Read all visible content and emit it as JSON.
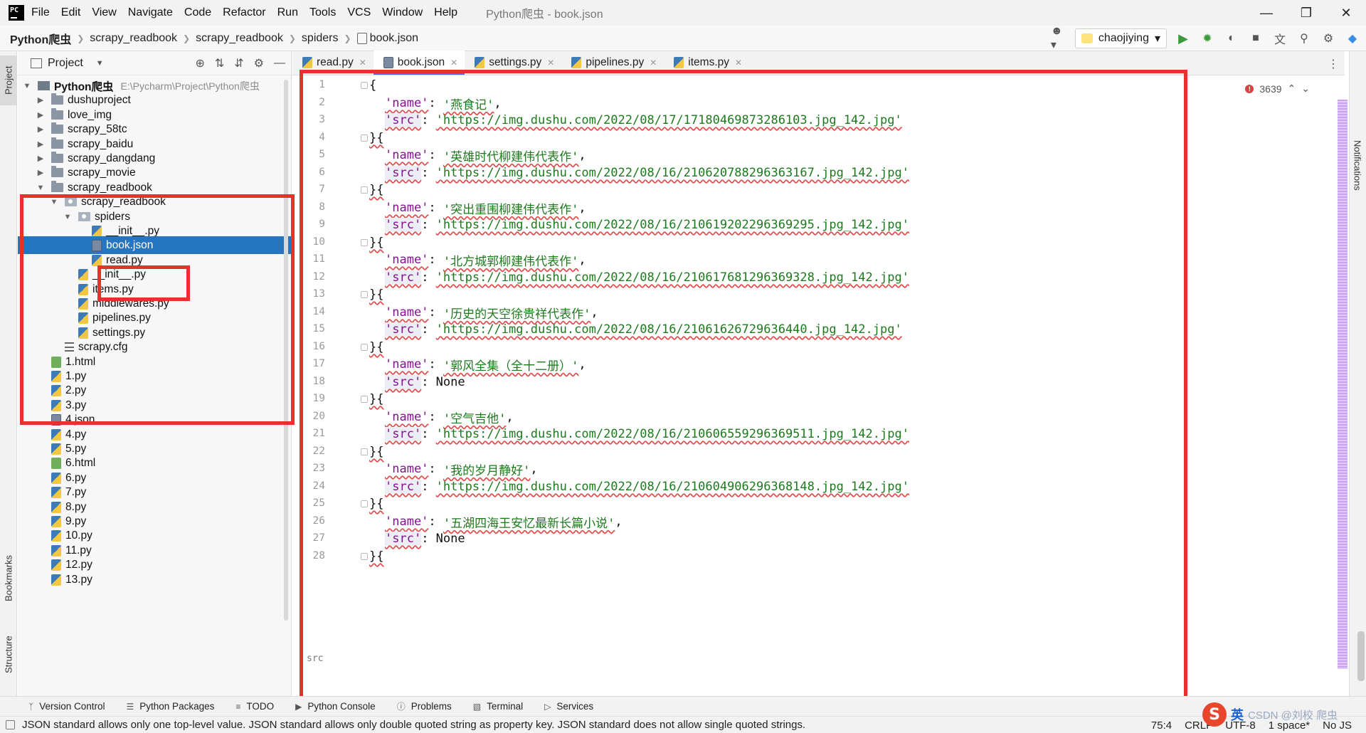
{
  "menubar": {
    "items": [
      "File",
      "Edit",
      "View",
      "Navigate",
      "Code",
      "Refactor",
      "Run",
      "Tools",
      "VCS",
      "Window",
      "Help"
    ],
    "window_title": "Python爬虫 - book.json"
  },
  "breadcrumb": [
    "Python爬虫",
    "scrapy_readbook",
    "scrapy_readbook",
    "spiders",
    "book.json"
  ],
  "toolbar": {
    "run_config": "chaojiying"
  },
  "project_panel": {
    "title": "Project",
    "root_name": "Python爬虫",
    "root_path": "E:\\Pycharm\\Project\\Python爬虫",
    "rows": [
      {
        "label": "dushuproject",
        "level": 1,
        "kind": "folder",
        "toggle": "collapsed"
      },
      {
        "label": "love_img",
        "level": 1,
        "kind": "folder",
        "toggle": "collapsed"
      },
      {
        "label": "scrapy_58tc",
        "level": 1,
        "kind": "folder",
        "toggle": "collapsed"
      },
      {
        "label": "scrapy_baidu",
        "level": 1,
        "kind": "folder",
        "toggle": "collapsed"
      },
      {
        "label": "scrapy_dangdang",
        "level": 1,
        "kind": "folder",
        "toggle": "collapsed"
      },
      {
        "label": "scrapy_movie",
        "level": 1,
        "kind": "folder",
        "toggle": "collapsed"
      },
      {
        "label": "scrapy_readbook",
        "level": 1,
        "kind": "folder",
        "toggle": "expanded"
      },
      {
        "label": "scrapy_readbook",
        "level": 2,
        "kind": "package",
        "toggle": "expanded"
      },
      {
        "label": "spiders",
        "level": 3,
        "kind": "package",
        "toggle": "expanded"
      },
      {
        "label": "__init__.py",
        "level": 4,
        "kind": "py",
        "toggle": ""
      },
      {
        "label": "book.json",
        "level": 4,
        "kind": "json",
        "toggle": "",
        "selected": true
      },
      {
        "label": "read.py",
        "level": 4,
        "kind": "py",
        "toggle": ""
      },
      {
        "label": "__init__.py",
        "level": 3,
        "kind": "py",
        "toggle": ""
      },
      {
        "label": "items.py",
        "level": 3,
        "kind": "py",
        "toggle": ""
      },
      {
        "label": "middlewares.py",
        "level": 3,
        "kind": "py",
        "toggle": ""
      },
      {
        "label": "pipelines.py",
        "level": 3,
        "kind": "py",
        "toggle": ""
      },
      {
        "label": "settings.py",
        "level": 3,
        "kind": "py",
        "toggle": ""
      },
      {
        "label": "scrapy.cfg",
        "level": 2,
        "kind": "cfg",
        "toggle": ""
      },
      {
        "label": "1.html",
        "level": 1,
        "kind": "html",
        "toggle": ""
      },
      {
        "label": "1.py",
        "level": 1,
        "kind": "py",
        "toggle": ""
      },
      {
        "label": "2.py",
        "level": 1,
        "kind": "py",
        "toggle": ""
      },
      {
        "label": "3.py",
        "level": 1,
        "kind": "py",
        "toggle": ""
      },
      {
        "label": "4.json",
        "level": 1,
        "kind": "json",
        "toggle": ""
      },
      {
        "label": "4.py",
        "level": 1,
        "kind": "py",
        "toggle": ""
      },
      {
        "label": "5.py",
        "level": 1,
        "kind": "py",
        "toggle": ""
      },
      {
        "label": "6.html",
        "level": 1,
        "kind": "html",
        "toggle": ""
      },
      {
        "label": "6.py",
        "level": 1,
        "kind": "py",
        "toggle": ""
      },
      {
        "label": "7.py",
        "level": 1,
        "kind": "py",
        "toggle": ""
      },
      {
        "label": "8.py",
        "level": 1,
        "kind": "py",
        "toggle": ""
      },
      {
        "label": "9.py",
        "level": 1,
        "kind": "py",
        "toggle": ""
      },
      {
        "label": "10.py",
        "level": 1,
        "kind": "py",
        "toggle": ""
      },
      {
        "label": "11.py",
        "level": 1,
        "kind": "py",
        "toggle": ""
      },
      {
        "label": "12.py",
        "level": 1,
        "kind": "py",
        "toggle": ""
      },
      {
        "label": "13.py",
        "level": 1,
        "kind": "py",
        "toggle": ""
      }
    ]
  },
  "editor_tabs": [
    {
      "label": "read.py",
      "kind": "py",
      "active": false
    },
    {
      "label": "book.json",
      "kind": "json",
      "active": true
    },
    {
      "label": "settings.py",
      "kind": "py",
      "active": false
    },
    {
      "label": "pipelines.py",
      "kind": "py",
      "active": false
    },
    {
      "label": "items.py",
      "kind": "py",
      "active": false
    }
  ],
  "editor": {
    "inspection_count": "3639",
    "breadcrumb_footer": "src",
    "records": [
      {
        "name": "'燕食记'",
        "src": "'https://img.dushu.com/2022/08/17/17180469873286103.jpg_142.jpg'"
      },
      {
        "name": "'英雄时代柳建伟代表作'",
        "src": "'https://img.dushu.com/2022/08/16/210620788296363167.jpg_142.jpg'"
      },
      {
        "name": "'突出重围柳建伟代表作'",
        "src": "'https://img.dushu.com/2022/08/16/210619202296369295.jpg_142.jpg'"
      },
      {
        "name": "'北方城郭柳建伟代表作'",
        "src": "'https://img.dushu.com/2022/08/16/210617681296369328.jpg_142.jpg'"
      },
      {
        "name": "'历史的天空徐贵祥代表作'",
        "src": "'https://img.dushu.com/2022/08/16/21061626729636440.jpg_142.jpg'"
      },
      {
        "name": "'郭风全集（全十二册）'",
        "src": "None"
      },
      {
        "name": "'空气吉他'",
        "src": "'https://img.dushu.com/2022/08/16/210606559296369511.jpg_142.jpg'"
      },
      {
        "name": "'我的岁月静好'",
        "src": "'https://img.dushu.com/2022/08/16/210604906296368148.jpg_142.jpg'"
      },
      {
        "name": "'五湖四海王安忆最新长篇小说'",
        "src": "None"
      }
    ],
    "key_name": "'name'",
    "key_src": "'src'"
  },
  "tool_windows": [
    "Version Control",
    "Python Packages",
    "TODO",
    "Python Console",
    "Problems",
    "Terminal",
    "Services"
  ],
  "side_tabs": {
    "project": "Project",
    "bookmarks": "Bookmarks",
    "structure": "Structure",
    "notifications": "Notifications"
  },
  "status_bar": {
    "message": "JSON standard allows only one top-level value. JSON standard allows only double quoted string as property key. JSON standard does not allow single quoted strings.",
    "position": "75:4",
    "line_sep": "CRLF",
    "encoding": "UTF-8",
    "indent": "1 space*",
    "schema": "No JS"
  },
  "ime": {
    "mode": "英",
    "watermark": "CSDN @刘校 爬虫"
  },
  "colors": {
    "selection": "#2675bf",
    "annotation_red": "#e8302f",
    "string_green": "#1c7a1c",
    "key_purple": "#871094"
  }
}
